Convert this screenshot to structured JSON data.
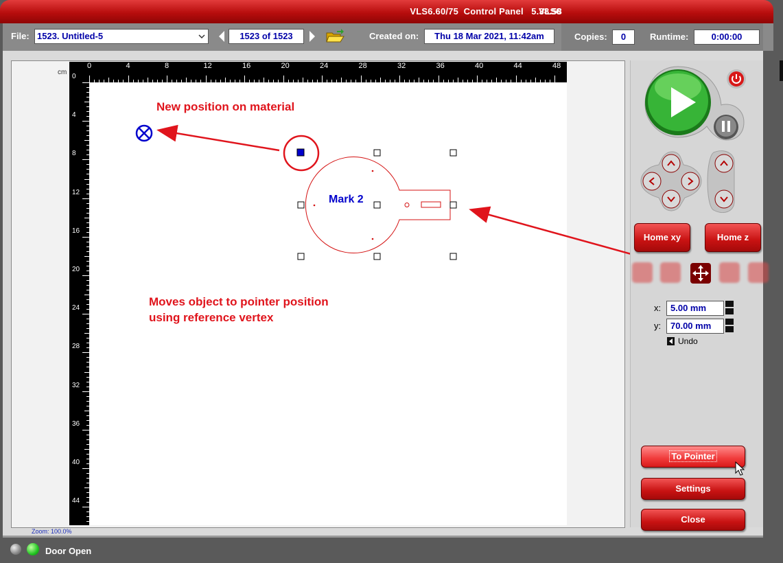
{
  "window": {
    "title": "VLS6.60/75  Control Panel   5.38.58",
    "title_tail": "VLS6"
  },
  "toolbar": {
    "file_label": "File:",
    "file_value": "1523. Untitled-5",
    "job_counter": "1523 of 1523",
    "created_label": "Created on:",
    "created_value": "Thu 18 Mar 2021, 11:42am",
    "copies_label": "Copies:",
    "copies_value": "0",
    "runtime_label": "Runtime:",
    "runtime_value": "0:00:00"
  },
  "ruler": {
    "unit": "cm",
    "top_labels": [
      "0",
      "4",
      "8",
      "12",
      "16",
      "20",
      "24",
      "28",
      "32",
      "36",
      "40",
      "44",
      "48"
    ],
    "left_labels": [
      "0",
      "4",
      "8",
      "12",
      "16",
      "20",
      "24",
      "28",
      "32",
      "36",
      "40",
      "44"
    ]
  },
  "canvas": {
    "object_label": "Mark 2",
    "zoom": "Zoom:  100.0%"
  },
  "annotations": {
    "new_position": "New position on material",
    "moves_line1": "Moves object to pointer position",
    "moves_line2": "using reference vertex"
  },
  "controls": {
    "home_xy": "Home xy",
    "home_z": "Home z",
    "x_label": "x:",
    "x_value": "5.00 mm",
    "y_label": "y:",
    "y_value": "70.00 mm",
    "undo": "Undo",
    "to_pointer": "To Pointer",
    "settings": "Settings",
    "close": "Close"
  },
  "status": {
    "door": "Door Open"
  },
  "colors": {
    "accent_red": "#c81212",
    "annotation_red": "#e0141c",
    "field_text": "#0000a8"
  }
}
